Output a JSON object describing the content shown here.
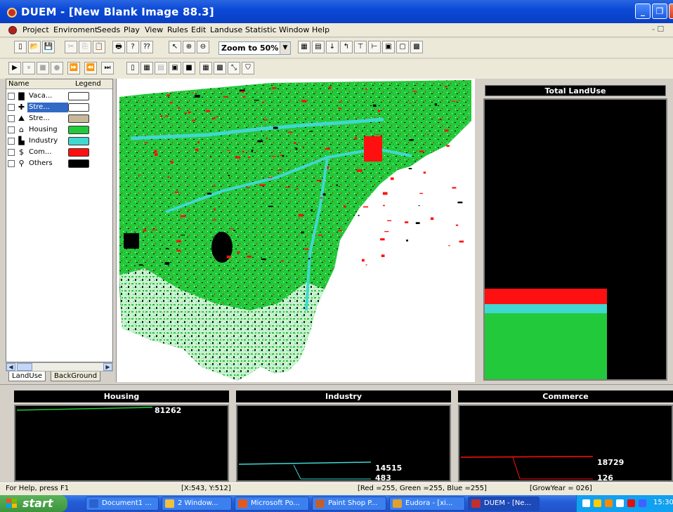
{
  "window": {
    "title": "DUEM - [New Blank Image  88.3]",
    "buttons": [
      "_",
      "❐",
      "✕"
    ]
  },
  "menu": {
    "items": [
      "Project",
      "Enviroment",
      "Seeds",
      "Play",
      "View",
      "Rules",
      "Edit",
      "Landuse",
      "Statistic",
      "Window",
      "Help"
    ],
    "mdi_controls": "- ☐"
  },
  "toolbar1": {
    "zoom_value": "Zoom to 50%",
    "zoom_arrow": "▼",
    "buttons": [
      "▯",
      "📂",
      "💾",
      "✂",
      "⎘",
      "📋",
      "🖶",
      "?",
      "⁇",
      "↖",
      "⊕",
      "⊖",
      "▦",
      "▤",
      "↓",
      "↰",
      "⊤",
      "⊢",
      "▣",
      "▢",
      "▩"
    ]
  },
  "toolbar2": {
    "buttons": [
      "▶",
      "⏸",
      "■",
      "●",
      "⏩",
      "⏪",
      "⏭",
      "▯",
      "▦",
      "▤",
      "▣",
      "■",
      "▦",
      "▩",
      "⤡",
      "⛉"
    ]
  },
  "layers": {
    "header_name": "Name",
    "header_legend": "Legend",
    "items": [
      {
        "label": "Vaca...",
        "color": "#ffffff",
        "icon": "▇"
      },
      {
        "label": "Stre...",
        "color": "#ffffff",
        "icon": "✚"
      },
      {
        "label": "Stre...",
        "color": "#c8b89a",
        "icon": "⛰"
      },
      {
        "label": "Housing",
        "color": "#22c93a",
        "icon": "⌂"
      },
      {
        "label": "Industry",
        "color": "#40d8d0",
        "icon": "▙"
      },
      {
        "label": "Com...",
        "color": "#ff1010",
        "icon": "$"
      },
      {
        "label": "Others",
        "color": "#000000",
        "icon": "⚲"
      }
    ],
    "selected_index": 1,
    "scroll_left": "◀",
    "scroll_right": "▶"
  },
  "tabs": [
    "LandUse",
    "BackGround"
  ],
  "colors": {
    "housing": "#22c93a",
    "industry": "#40d8d0",
    "commerce": "#ff1010",
    "others": "#000000"
  },
  "total_landuse": {
    "title": "Total LandUse",
    "housing_fraction": 0.235,
    "industry_fraction": 0.035,
    "commerce_fraction": 0.055
  },
  "charts": {
    "housing": {
      "title": "Housing",
      "value": "81262"
    },
    "industry": {
      "title": "Industry",
      "value": "14515",
      "value2": "483"
    },
    "commerce": {
      "title": "Commerce",
      "value": "18729",
      "value2": "126"
    }
  },
  "status": {
    "help": "For Help, press F1",
    "coords": "[X:543, Y:512]",
    "rgb": "[Red =255, Green =255, Blue =255]",
    "grow_year": "[GrowYear = 026]"
  },
  "taskbar": {
    "start": "start",
    "tasks": [
      {
        "label": "Document1 ...",
        "color": "#2a62d0"
      },
      {
        "label": "2 Window...",
        "color": "#f0c040"
      },
      {
        "label": "Microsoft Po...",
        "color": "#e05a20"
      },
      {
        "label": "Paint Shop P...",
        "color": "#c06030"
      },
      {
        "label": "Eudora - [xi...",
        "color": "#e0a030"
      },
      {
        "label": "DUEM - [Ne...",
        "color": "#c03030"
      }
    ],
    "clock": "15:30"
  }
}
